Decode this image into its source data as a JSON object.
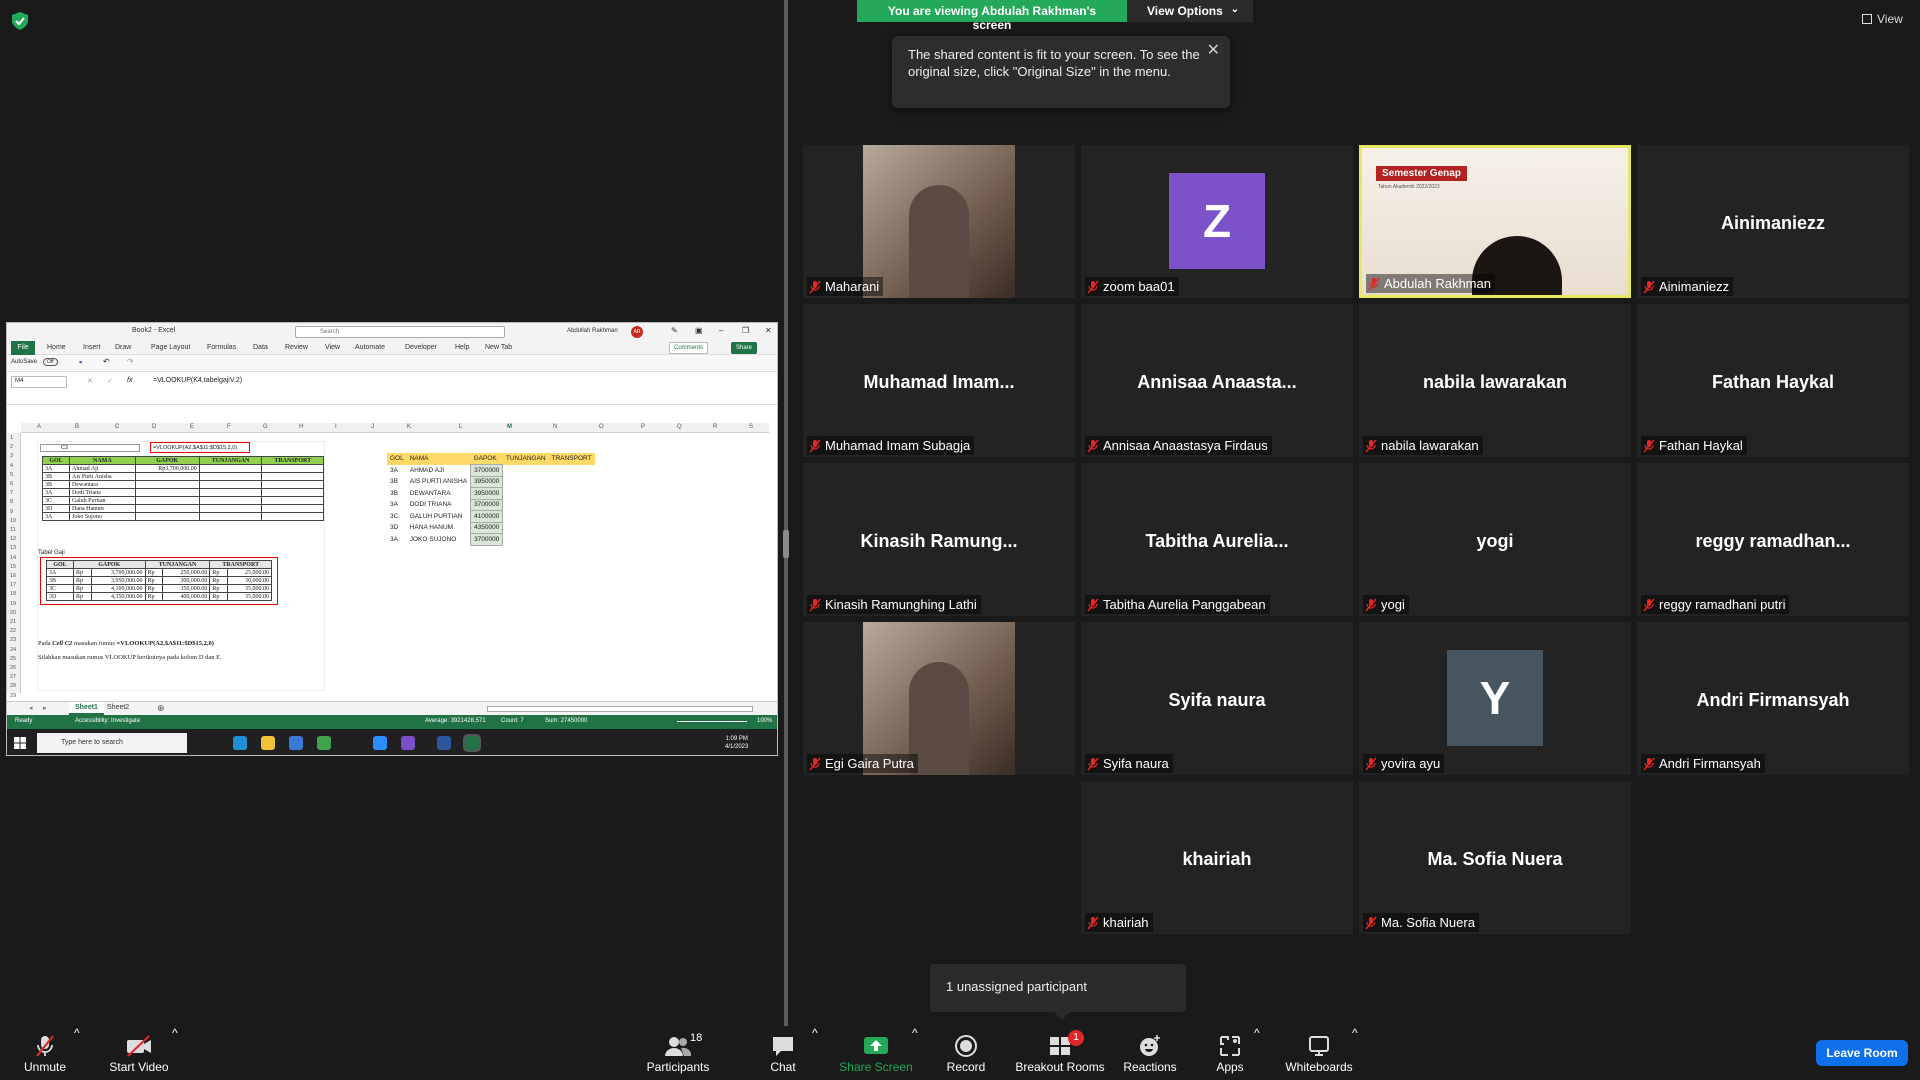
{
  "banner": {
    "viewing": "You are viewing Abdulah Rakhman's screen",
    "view_options": "View Options"
  },
  "tooltip": {
    "text": "The shared content is fit to your screen. To see the original size, click \"Original Size\" in the menu."
  },
  "top_right": {
    "view_label": "View"
  },
  "excel": {
    "title": "Book2 - Excel",
    "search_placeholder": "Search",
    "user": "Abdullah Rakhman",
    "user_initials": "AR",
    "tabs": [
      "File",
      "Home",
      "Insert",
      "Draw",
      "Page Layout",
      "Formulas",
      "Data",
      "Review",
      "View",
      "Automate",
      "Developer",
      "Help",
      "New Tab"
    ],
    "comments": "Comments",
    "share": "Share",
    "autosave": "AutoSave",
    "autosave_state": "Off",
    "name_box": "M4",
    "formula": "=VLOOKUP(K4,tabelgajiV,2)",
    "col_letters": [
      "A",
      "B",
      "C",
      "D",
      "E",
      "F",
      "G",
      "H",
      "I",
      "J",
      "K",
      "L",
      "M",
      "N",
      "O",
      "P",
      "Q",
      "R",
      "S"
    ],
    "row_numbers": [
      "1",
      "2",
      "3",
      "4",
      "5",
      "6",
      "7",
      "8",
      "9",
      "10",
      "11",
      "12",
      "13",
      "14",
      "15",
      "16",
      "17",
      "18",
      "19",
      "20",
      "21",
      "22",
      "23",
      "24",
      "25",
      "26",
      "27",
      "28",
      "29"
    ],
    "picture": {
      "cellref": "C2",
      "formula": "=VLOOKUP(A2,$A$11:$D$15,2,0)",
      "headers": [
        "GOL",
        "NAMA",
        "GAPOK",
        "TUNJANGAN",
        "TRANSPORT"
      ],
      "rows": [
        [
          "3A",
          "Ahmad Aji",
          "Rp3,700,000.00"
        ],
        [
          "3B",
          "Ais Purti Anisha",
          ""
        ],
        [
          "3B",
          "Dewantara",
          ""
        ],
        [
          "3A",
          "Dodi Triana",
          ""
        ],
        [
          "3C",
          "Galuh Purtian",
          ""
        ],
        [
          "3D",
          "Hana Hanum",
          ""
        ],
        [
          "3A",
          "Joko Sujono",
          ""
        ]
      ],
      "tabel_gaji_label": "Tabel Gaji",
      "gaji_headers": [
        "GOL",
        "GAPOK",
        "TUNJANGAN",
        "TRANSPORT"
      ],
      "gaji_rows": [
        [
          "3A",
          "Rp",
          "3,700,000.00",
          "Rp",
          "250,000.00",
          "Rp",
          "25,000.00"
        ],
        [
          "3B",
          "Rp",
          "3,950,000.00",
          "Rp",
          "300,000.00",
          "Rp",
          "30,000.00"
        ],
        [
          "3C",
          "Rp",
          "4,100,000.00",
          "Rp",
          "350,000.00",
          "Rp",
          "35,000.00"
        ],
        [
          "3D",
          "Rp",
          "4,350,000.00",
          "Rp",
          "400,000.00",
          "Rp",
          "35,000.00"
        ]
      ],
      "instruction_1_prefix": "Pada",
      "instruction_1_cell": "Cell C2",
      "instruction_1_mid": "masukan rumus",
      "instruction_1_formula": "=VLOOKUP(A2,$A$11:$D$15,2,0)",
      "instruction_2": "Silahkan masukan rumus VLOOKUP berikutnya pada kolom D dan E."
    },
    "right_table": {
      "headers": [
        "GOL",
        "NAMA",
        "GAPOK",
        "TUNJANGAN",
        "TRANSPORT"
      ],
      "rows": [
        [
          "3A",
          "AHMAD AJI",
          "3700000"
        ],
        [
          "3B",
          "AIS PURTI ANISHA",
          "3950000"
        ],
        [
          "3B",
          "DEWANTARA",
          "3950000"
        ],
        [
          "3A",
          "DODI TRIANA",
          "3700000"
        ],
        [
          "3C",
          "GALUH PURTIAN",
          "4100000"
        ],
        [
          "3D",
          "HANA HANUM",
          "4350000"
        ],
        [
          "3A",
          "JOKO SUJONO",
          "3700000"
        ]
      ]
    },
    "sheets": [
      "Sheet1",
      "Sheet2"
    ],
    "status": {
      "ready": "Ready",
      "accessibility": "Accessibility: Investigate",
      "average": "Average: 3921428.571",
      "count": "Count: 7",
      "sum": "Sum: 27450000",
      "zoom": "100%"
    },
    "taskbar": {
      "search": "Type here to search",
      "time": "1:09 PM",
      "date": "4/1/2023"
    }
  },
  "participants": [
    {
      "display": "",
      "label": "Maharani",
      "type": "video"
    },
    {
      "display": "Z",
      "label": "zoom baa01",
      "type": "letter",
      "color": "#7c52c8"
    },
    {
      "display": "",
      "label": "Abdulah Rakhman",
      "type": "video-active"
    },
    {
      "display": "Ainimaniezz",
      "label": "Ainimaniezz",
      "type": "name"
    },
    {
      "display": "Muhamad  Imam...",
      "label": "Muhamad Imam Subagja",
      "type": "name"
    },
    {
      "display": "Annisaa  Anaasta...",
      "label": "Annisaa Anaastasya Firdaus",
      "type": "name"
    },
    {
      "display": "nabila lawarakan",
      "label": "nabila lawarakan",
      "type": "name"
    },
    {
      "display": "Fathan Haykal",
      "label": "Fathan Haykal",
      "type": "name"
    },
    {
      "display": "Kinasih  Ramung...",
      "label": "Kinasih Ramunghing Lathi",
      "type": "name"
    },
    {
      "display": "Tabitha  Aurelia...",
      "label": "Tabitha Aurelia Panggabean",
      "type": "name"
    },
    {
      "display": "yogi",
      "label": "yogi",
      "type": "name"
    },
    {
      "display": "reggy  ramadhan...",
      "label": "reggy ramadhani putri",
      "type": "name"
    },
    {
      "display": "",
      "label": "Egi Gaira Putra",
      "type": "video"
    },
    {
      "display": "Syifa naura",
      "label": "Syifa naura",
      "type": "name"
    },
    {
      "display": "Y",
      "label": "yovira ayu",
      "type": "letter",
      "color": "#46555f"
    },
    {
      "display": "Andri Firmansyah",
      "label": "Andri Firmansyah",
      "type": "name"
    },
    {
      "display": "khairiah",
      "label": "khairiah",
      "type": "name"
    },
    {
      "display": "Ma. Sofia Nuera",
      "label": "Ma. Sofia Nuera",
      "type": "name"
    }
  ],
  "slide_overlay": {
    "title": "Semester Genap",
    "subtitle": "Tahun Akademik 2022/2023"
  },
  "unassigned": "1 unassigned participant",
  "toolbar": {
    "unmute": "Unmute",
    "start_video": "Start Video",
    "participants": "Participants",
    "participants_count": "18",
    "chat": "Chat",
    "share_screen": "Share Screen",
    "record": "Record",
    "breakout_rooms": "Breakout Rooms",
    "breakout_badge": "1",
    "reactions": "Reactions",
    "apps": "Apps",
    "whiteboards": "Whiteboards",
    "leave": "Leave Room"
  },
  "colors": {
    "share_green": "#23a959",
    "leave_blue": "#0e71eb",
    "excel_green": "#217346",
    "active_border": "#e8e860"
  }
}
